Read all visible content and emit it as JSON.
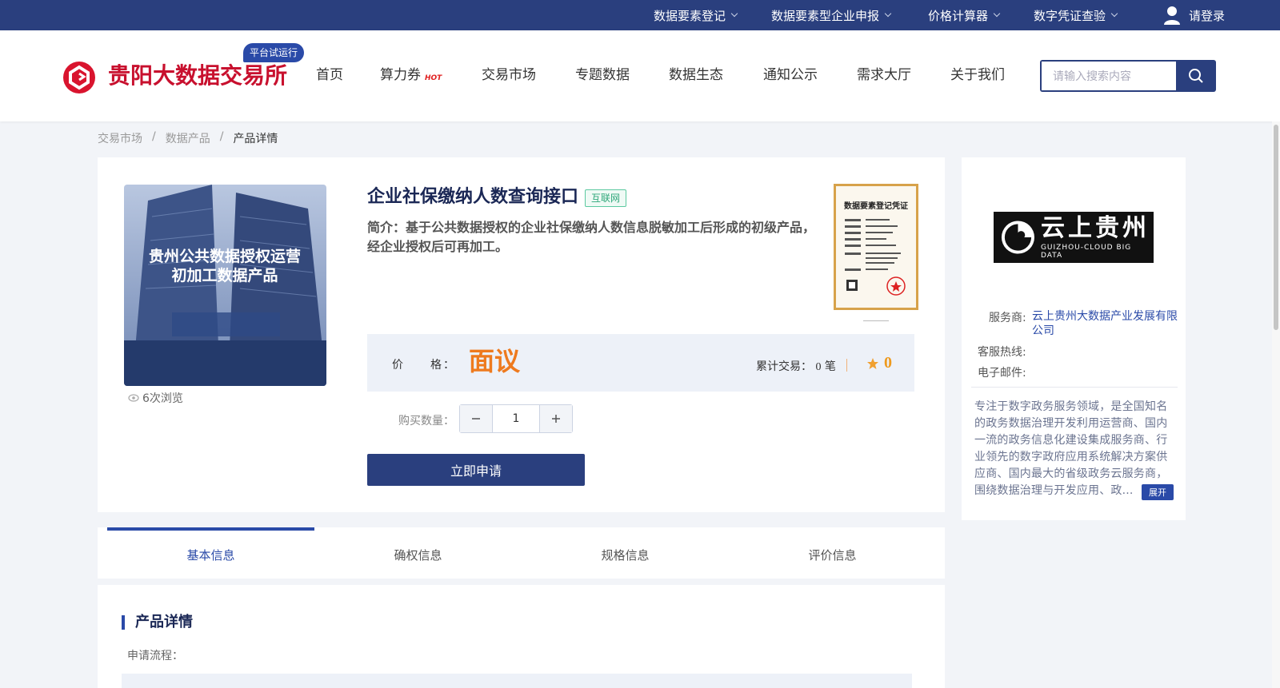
{
  "topbar": {
    "menus": [
      "数据要素登记",
      "数据要素型企业申报",
      "价格计算器",
      "数字凭证查验"
    ],
    "login": "请登录"
  },
  "header": {
    "logo_text": "贵阳大数据交易所",
    "trial_badge": "平台试运行",
    "nav": [
      "首页",
      "算力券",
      "交易市场",
      "专题数据",
      "数据生态",
      "通知公示",
      "需求大厅",
      "关于我们"
    ],
    "hot_tag": "HOT",
    "search_placeholder": "请输入搜索内容"
  },
  "breadcrumb": [
    "交易市场",
    "数据产品",
    "产品详情"
  ],
  "product": {
    "image_text_line1": "贵州公共数据授权运营",
    "image_text_line2": "初加工数据产品",
    "views": "6次浏览",
    "title": "企业社保缴纳人数查询接口",
    "tag": "互联网",
    "intro": "简介：基于公共数据授权的企业社保缴纳人数信息脱敏加工后形成的初级产品，经企业授权后可再加工。",
    "cert_title": "数据要素登记凭证",
    "price_label": "价　　格：",
    "price_value": "面议",
    "trade_label": "累计交易：",
    "trade_count": "0",
    "trade_unit": "笔",
    "score": "0",
    "qty_label": "购买数量：",
    "qty_value": "1",
    "apply_label": "立即申请"
  },
  "tabs": [
    "基本信息",
    "确权信息",
    "规格信息",
    "评价信息"
  ],
  "details": {
    "title": "产品详情",
    "sub": "申请流程："
  },
  "provider": {
    "logo_text": "云上贵州",
    "logo_sub": "GUIZHOU-CLOUD BIG DATA",
    "service_label": "服务商:",
    "service_value": "云上贵州大数据产业发展有限公司",
    "hotline_label": "客服热线:",
    "email_label": "电子邮件:",
    "description": "专注于数字政务服务领域，是全国知名的政务数据治理开发利用运营商、国内一流的政务信息化建设集成服务商、行业领先的数字政府应用系统解决方案供应商、国内最大的省级政务云服务商，围绕数据治理与开发应用、政...",
    "expand_label": "展开"
  },
  "colors": {
    "primary": "#2a3f7e",
    "accent_blue": "#2a4aa8",
    "price_orange": "#ee7a1e",
    "logo_red": "#c8102e"
  }
}
